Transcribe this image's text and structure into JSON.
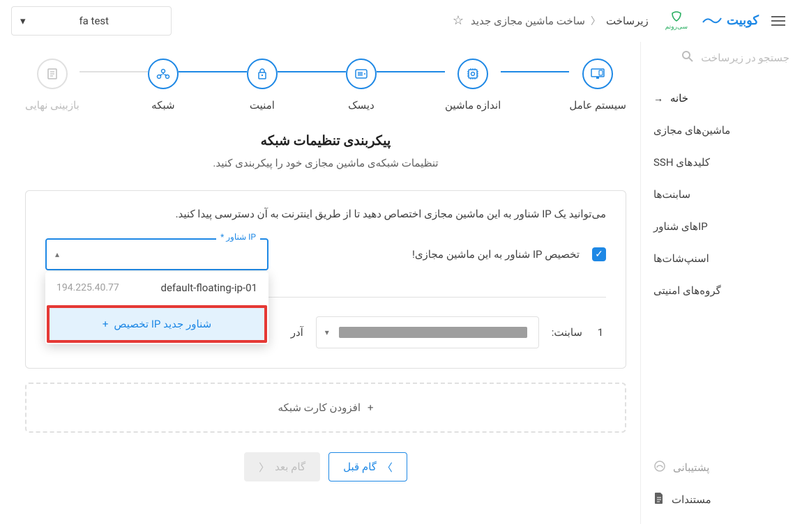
{
  "header": {
    "logo_text": "کوبیت",
    "breadcrumb_root": "زیرساخت",
    "breadcrumb_current": "ساخت ماشین مجازی جدید",
    "project_selected": "fa test"
  },
  "sidebar": {
    "search_placeholder": "جستجو در زیرساخت",
    "home": "خانه",
    "items": [
      "ماشین‌های مجازی",
      "کلیدهای SSH",
      "سابنت‌ها",
      "IPهای شناور",
      "اسنپ‌شات‌ها",
      "گروه‌های امنیتی"
    ],
    "support": "پشتیبانی",
    "docs": "مستندات"
  },
  "stepper": {
    "steps": [
      "سیستم عامل",
      "اندازه ماشین",
      "دیسک",
      "امنیت",
      "شبکه",
      "بازبینی نهایی"
    ]
  },
  "section": {
    "title": "پیکربندی تنظیمات شبکه",
    "subtitle": "تنظیمات شبکه‌ی ماشین مجازی خود را پیکربندی کنید."
  },
  "card": {
    "hint": "می‌توانید یک IP شناور به این ماشین مجازی اختصاص دهید تا از طریق اینترنت به آن دسترسی پیدا کنید.",
    "checkbox_label": "تخصیص IP شناور به این ماشین مجازی!",
    "float_label": "IP شناور *",
    "dropdown": {
      "option_name": "default-floating-ip-01",
      "option_ip": "194.225.40.77",
      "action_label": "تخصیص IP شناور جدید"
    },
    "subnet": {
      "index": "1",
      "label": "سابنت:",
      "addr_label": "آدر"
    }
  },
  "add_card_label": "افزودن کارت شبکه",
  "nav": {
    "prev": "گام قبل",
    "next": "گام بعد"
  }
}
